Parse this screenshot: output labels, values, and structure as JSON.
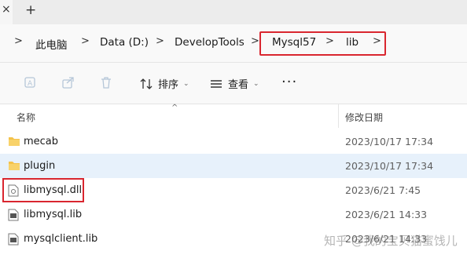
{
  "tabbar": {
    "new_tab": "+"
  },
  "address": {
    "crumbs": [
      "此电脑",
      "Data (D:)",
      "DevelopTools",
      "Mysql57",
      "lib"
    ]
  },
  "toolbar": {
    "sort_label": "排序",
    "view_label": "查看",
    "more_label": "···"
  },
  "columns": {
    "name": "名称",
    "modified": "修改日期"
  },
  "files": [
    {
      "name": "mecab",
      "date": "2023/10/17 17:34",
      "type": "folder"
    },
    {
      "name": "plugin",
      "date": "2023/10/17 17:34",
      "type": "folder"
    },
    {
      "name": "libmysql.dll",
      "date": "2023/6/21 7:45",
      "type": "dll"
    },
    {
      "name": "libmysql.lib",
      "date": "2023/6/21 14:33",
      "type": "lib"
    },
    {
      "name": "mysqlclient.lib",
      "date": "2023/6/21 14:33",
      "type": "lib"
    }
  ],
  "watermark": "知乎 @我的宝贝猫蜜饯儿",
  "colors": {
    "highlight": "#d9262f",
    "folder": "#f4c24a",
    "selected_row": "#e7f1fb"
  }
}
